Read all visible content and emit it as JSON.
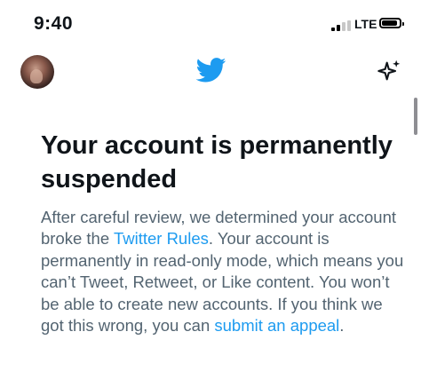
{
  "status_bar": {
    "time": "9:40",
    "network": "LTE",
    "signal_bars_active": 2,
    "signal_bars_total": 4,
    "battery_level": 0.85
  },
  "header": {
    "logo_icon": "twitter-bird-icon",
    "action_icon": "sparkle-icon"
  },
  "notice": {
    "title": "Your account is permanently suspended",
    "body_part1": "After careful review, we determined your account broke the ",
    "rules_link": "Twitter Rules",
    "body_part2": ". Your account is permanently in read-only mode, which means you can’t Tweet, Retweet, or Like content. You won’t be able to create new accounts. If you think we got this wrong, you can ",
    "appeal_link": "submit an appeal",
    "body_part3": "."
  },
  "colors": {
    "brand_blue": "#1d9bf0",
    "text_primary": "#0f1419",
    "text_secondary": "#536471"
  }
}
